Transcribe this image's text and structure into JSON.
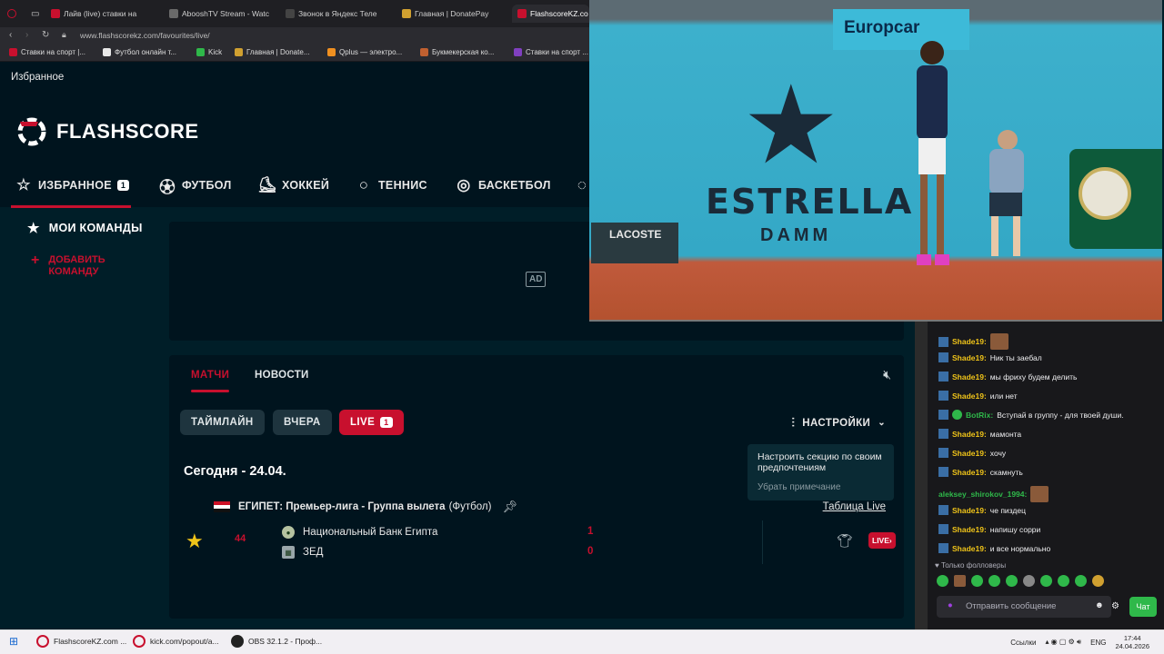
{
  "browser": {
    "tabs": [
      {
        "label": "Лайв (live) ставки на",
        "color": "#c8102e"
      },
      {
        "label": "AbooshTV Stream - Watc",
        "color": "#6a6a6a"
      },
      {
        "label": "Звонок в Яндекс Теле",
        "color": "#444"
      },
      {
        "label": "Главная | DonatePay",
        "color": "#d0a030"
      },
      {
        "label": "FlashscoreKZ.co",
        "color": "#c8102e"
      }
    ],
    "url": "www.flashscorekz.com/favourites/live/",
    "bookmarks": [
      {
        "label": "Ставки на спорт |...",
        "color": "#c8102e"
      },
      {
        "label": "Футбол онлайн т...",
        "color": "#e8e8e8"
      },
      {
        "label": "Kick",
        "color": "#2fb84a"
      },
      {
        "label": "Главная | Donate...",
        "color": "#d0a030"
      },
      {
        "label": "Qplus — электро...",
        "color": "#f09020"
      },
      {
        "label": "Букмекерская ко...",
        "color": "#c06030"
      },
      {
        "label": "Ставки на спорт ...",
        "color": "#8040c0"
      }
    ]
  },
  "flashscore": {
    "favorites_bar": "Избранное",
    "logo": "FLASHSCORE",
    "nav": [
      {
        "label": "ИЗБРАННОЕ",
        "icon": "star-icon",
        "badge": "1"
      },
      {
        "label": "ФУТБОЛ",
        "icon": "football-icon"
      },
      {
        "label": "ХОККЕЙ",
        "icon": "hockey-icon"
      },
      {
        "label": "ТЕННИС",
        "icon": "tennis-icon"
      },
      {
        "label": "БАСКЕТБОЛ",
        "icon": "basketball-icon"
      }
    ],
    "sidebar": {
      "my_teams": "МОИ КОМАНДЫ",
      "add_team_line1": "ДОБАВИТЬ",
      "add_team_line2": "КОМАНДУ"
    },
    "ad_label": "AD",
    "matches_tabs": [
      "МАТЧИ",
      "НОВОСТИ"
    ],
    "filters": {
      "timeline": "ТАЙМЛАЙН",
      "yesterday": "ВЧЕРА",
      "live": "LIVE",
      "live_count": "1"
    },
    "settings_label": "НАСТРОЙКИ",
    "tooltip": {
      "text": "Настроить секцию по своим предпочтениям",
      "dismiss": "Убрать примечание"
    },
    "date_heading": "Сегодня - 24.04.",
    "league": {
      "name": "ЕГИПЕТ: Премьер-лига - Группа вылета",
      "sport": "(Футбол)",
      "table_link": "Таблица Live"
    },
    "match": {
      "minute": "44",
      "home": "Национальный Банк Египта",
      "away": "ЗЕД",
      "home_score": "1",
      "away_score": "0",
      "live_label": "LIVE"
    }
  },
  "video": {
    "sponsor1": "Europcar",
    "sponsor2": "ESTRELLA",
    "sponsor2_sub": "DAMM",
    "sponsor3": "LACOSTE"
  },
  "chat": {
    "messages": [
      {
        "nick": "Shade19:",
        "text": "",
        "emote": true,
        "color": "#f0c419"
      },
      {
        "nick": "Shade19:",
        "text": "Ник ты заебал",
        "color": "#f0c419"
      },
      {
        "nick": "Shade19:",
        "text": "мы фриху будем делить",
        "color": "#f0c419"
      },
      {
        "nick": "Shade19:",
        "text": "или нет",
        "color": "#f0c419"
      },
      {
        "nick": "BotRix:",
        "text": "Вступай в группу - для твоей души.",
        "color": "#2fb84a"
      },
      {
        "nick": "Shade19:",
        "text": "мамонта",
        "color": "#f0c419"
      },
      {
        "nick": "Shade19:",
        "text": "хочу",
        "color": "#f0c419"
      },
      {
        "nick": "Shade19:",
        "text": "скамнуть",
        "color": "#f0c419"
      },
      {
        "nick": "aleksey_shirokov_1994:",
        "text": "",
        "emote": true,
        "color": "#2fb84a"
      },
      {
        "nick": "Shade19:",
        "text": "че пиздец",
        "color": "#f0c419"
      },
      {
        "nick": "Shade19:",
        "text": "напишу сорри",
        "color": "#f0c419"
      },
      {
        "nick": "Shade19:",
        "text": "и все нормально",
        "color": "#f0c419"
      }
    ],
    "followers_only": "Только фолловеры",
    "input_placeholder": "Отправить сообщение",
    "send_label": "Чат"
  },
  "taskbar": {
    "items": [
      "FlashscoreKZ.com ...",
      "kick.com/popout/a...",
      "OBS 32.1.2 - Проф..."
    ],
    "links_label": "Ссылки",
    "lang": "ENG",
    "time": "17:44",
    "date": "24.04.2026"
  }
}
